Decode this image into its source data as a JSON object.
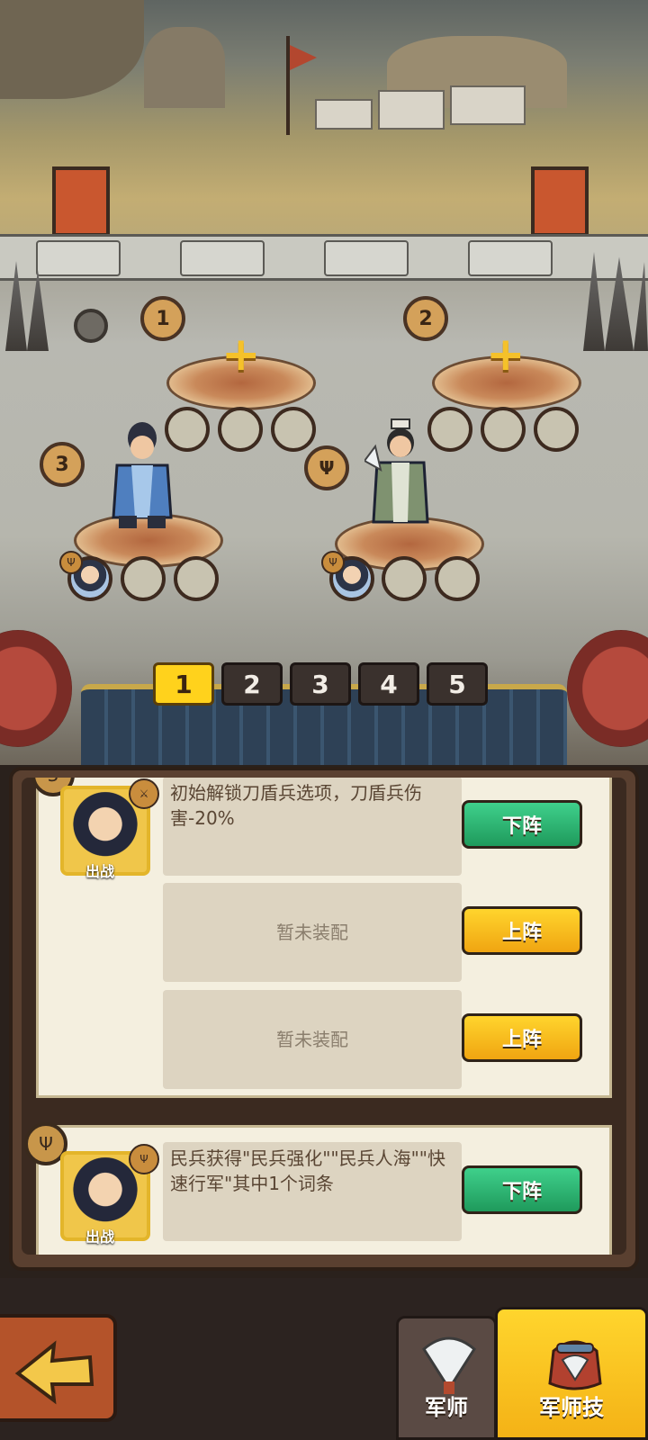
{
  "battlefield": {
    "positions": [
      "1",
      "2",
      "3"
    ],
    "add_symbol": "+"
  },
  "formation_tabs": [
    {
      "label": "1",
      "active": true
    },
    {
      "label": "2",
      "active": false
    },
    {
      "label": "3",
      "active": false
    },
    {
      "label": "4",
      "active": false
    },
    {
      "label": "5",
      "active": false
    }
  ],
  "cards": [
    {
      "portrait_label": "出战",
      "skills": [
        {
          "text": "初始解锁刀盾兵选项，刀盾兵伤害-20%",
          "button": "下阵",
          "button_style": "green"
        },
        {
          "text": "暂未装配",
          "button": "上阵",
          "button_style": "yellow"
        },
        {
          "text": "暂未装配",
          "button": "上阵",
          "button_style": "yellow"
        }
      ]
    },
    {
      "portrait_label": "出战",
      "skills": [
        {
          "text": "民兵获得\"民兵强化\"\"民兵人海\"\"快速行军\"其中1个词条",
          "button": "下阵",
          "button_style": "green"
        }
      ]
    }
  ],
  "bottom_tabs": [
    {
      "label": "军师",
      "icon": "fan-icon",
      "active": false
    },
    {
      "label": "军师技",
      "icon": "bag-icon",
      "active": true
    }
  ],
  "colors": {
    "active_tab": "#ffd21c",
    "green_button": "#1f9a5c",
    "yellow_button": "#f0a511"
  }
}
